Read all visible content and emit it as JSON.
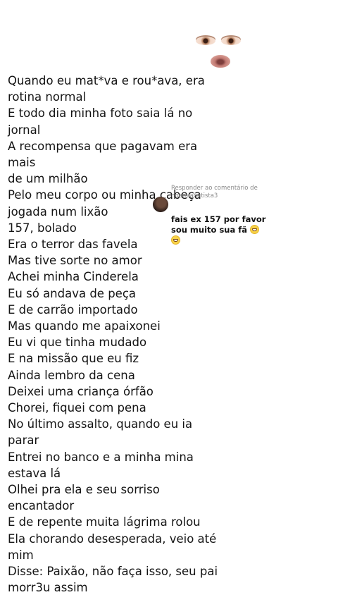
{
  "lyrics": [
    "Quando eu mat*va e rou*ava, era",
    "rotina normal",
    "E todo dia minha foto saia lá no jornal",
    "A recompensa que pagavam era mais",
    "de um milhão",
    "Pelo meu corpo ou minha cabeça",
    "jogada num lixão",
    "157, bolado",
    "Era o terror das favela",
    "Mas tive sorte no amor",
    "Achei minha Cinderela",
    "Eu só andava de peça",
    "E de carrão importado",
    "Mas quando me apaixonei",
    "Eu vi que tinha mudado",
    "E na missão que eu fiz",
    "Ainda lembro da cena",
    "Deixei uma criança órfão",
    "Chorei, fiquei com pena",
    "No último assalto, quando eu ia parar",
    "Entrei no banco e a minha mina",
    "estava lá",
    "Olhei pra ela e seu sorriso encantador",
    "E de repente muita lágrima rolou",
    "Ela chorando desesperada, veio até",
    "mim",
    "Disse: Paixão, não faça isso, seu pai",
    "morr3u assim"
  ],
  "reply": {
    "header_line1": "Responder ao comentário de",
    "header_line2": "noemiabatista3",
    "comment_line1": "fais ex 157 por favor",
    "comment_line2": "sou muito sua fã",
    "emoji_icon": "grinning-face-icon"
  }
}
